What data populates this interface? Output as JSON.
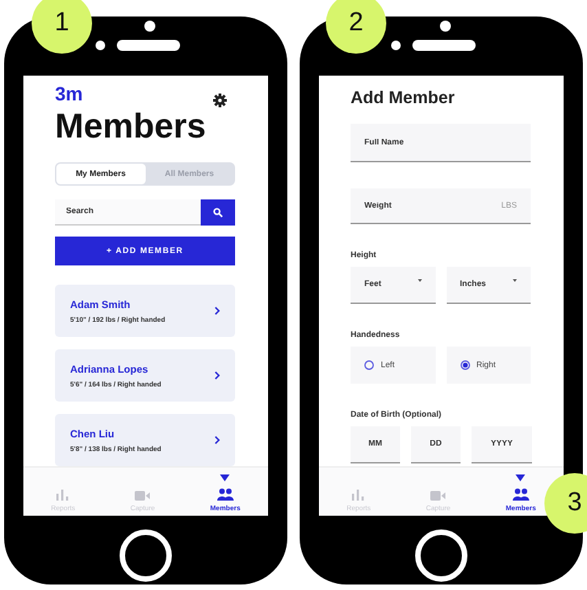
{
  "callouts": [
    {
      "label": "1"
    },
    {
      "label": "2"
    },
    {
      "label": "3"
    }
  ],
  "members_screen": {
    "logo": "3m",
    "title": "Members",
    "tabs": [
      {
        "label": "My Members",
        "selected": true
      },
      {
        "label": "All Members",
        "selected": false
      }
    ],
    "search": {
      "placeholder": "Search"
    },
    "add_button": "+ ADD MEMBER",
    "members": [
      {
        "name": "Adam Smith",
        "details": "5'10\" / 192 lbs / Right handed"
      },
      {
        "name": "Adrianna Lopes",
        "details": "5'6\" / 164 lbs / Right handed"
      },
      {
        "name": "Chen Liu",
        "details": "5'8\" / 138 lbs / Right handed"
      }
    ],
    "nav": [
      {
        "kind": "chart",
        "label": "Reports",
        "selected": false
      },
      {
        "kind": "video",
        "label": "Capture",
        "selected": false
      },
      {
        "kind": "people",
        "label": "Members",
        "selected": true
      }
    ]
  },
  "add_member_screen": {
    "title": "Add Member",
    "full_name": {
      "placeholder": "Full Name"
    },
    "weight": {
      "placeholder": "Weight",
      "unit": "LBS"
    },
    "height": {
      "label": "Height",
      "selects": [
        {
          "placeholder": "Feet"
        },
        {
          "placeholder": "Inches"
        }
      ]
    },
    "handedness": {
      "label": "Handedness",
      "options": [
        {
          "label": "Left",
          "selected": false
        },
        {
          "label": "Right",
          "selected": true
        }
      ]
    },
    "dob": {
      "label": "Date of Birth (Optional)",
      "fields": [
        {
          "placeholder": "MM"
        },
        {
          "placeholder": "DD"
        },
        {
          "placeholder": "YYYY"
        }
      ]
    },
    "nav": [
      {
        "kind": "chart",
        "label": "Reports",
        "selected": false
      },
      {
        "kind": "video",
        "label": "Capture",
        "selected": false
      },
      {
        "kind": "people",
        "label": "Members",
        "selected": true
      }
    ]
  }
}
